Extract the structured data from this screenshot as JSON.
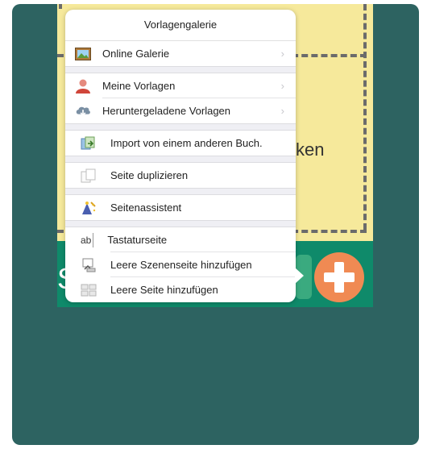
{
  "popover": {
    "title": "Vorlagengalerie",
    "groups": [
      {
        "items": [
          {
            "label": "Online Galerie",
            "icon": "picture-frame-icon",
            "chevron": "›"
          }
        ]
      },
      {
        "items": [
          {
            "label": "Meine Vorlagen",
            "icon": "user-icon",
            "chevron": "›"
          },
          {
            "label": "Heruntergeladene Vorlagen",
            "icon": "cloud-download-icon",
            "chevron": "›"
          }
        ]
      },
      {
        "items": [
          {
            "label": "Import von einem anderen Buch.",
            "icon": "import-book-icon"
          }
        ]
      },
      {
        "items": [
          {
            "label": "Seite duplizieren",
            "icon": "duplicate-page-icon"
          }
        ]
      },
      {
        "items": [
          {
            "label": "Seitenassistent",
            "icon": "wizard-icon"
          }
        ]
      },
      {
        "items": [
          {
            "label": "Tastaturseite",
            "icon": "keyboard-page-icon",
            "icon_text": "ab"
          },
          {
            "label": "Leere Szenenseite hinzufügen",
            "icon": "scene-page-icon"
          },
          {
            "label": "Leere Seite hinzufügen",
            "icon": "blank-page-icon"
          }
        ]
      }
    ]
  },
  "background": {
    "partial_word": "ken",
    "partial_letter": "S"
  },
  "colors": {
    "frame": "#2d6361",
    "page": "#f6e99b",
    "bar": "#0f8a6a",
    "plus": "#f08a53"
  }
}
